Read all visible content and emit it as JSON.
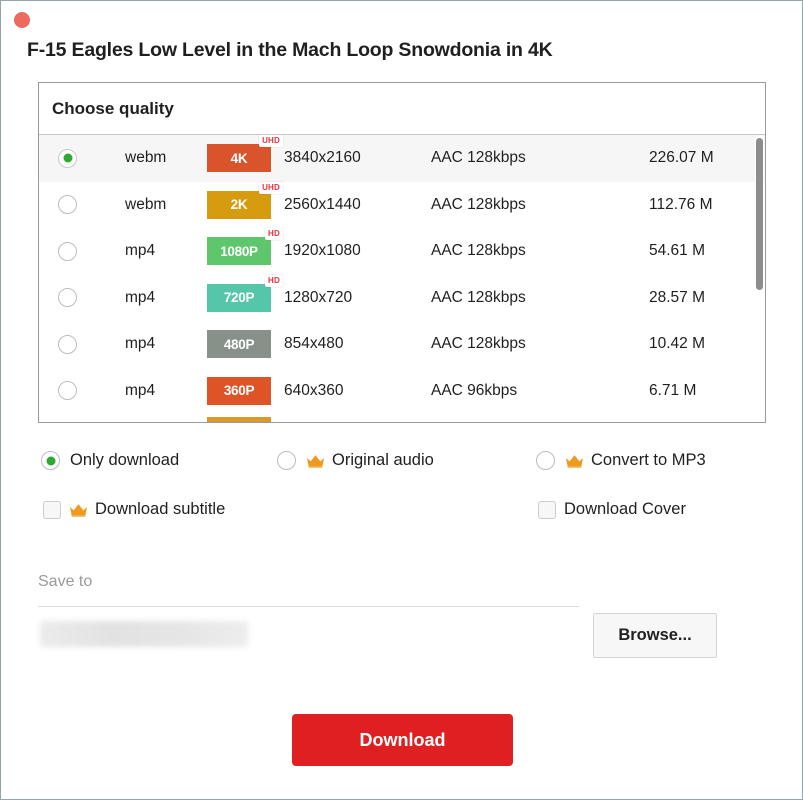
{
  "window": {
    "close_label": "close",
    "video_title": "F-15 Eagles Low Level in the Mach Loop Snowdonia in 4K"
  },
  "quality_panel": {
    "header_label": "Choose quality",
    "rows": [
      {
        "format": "webm",
        "badge": "4K",
        "badge_tag": "UHD",
        "badge_color": "#d9542b",
        "resolution": "3840x2160",
        "audio": "AAC 128kbps",
        "size": "226.07 M",
        "selected": true
      },
      {
        "format": "webm",
        "badge": "2K",
        "badge_tag": "UHD",
        "badge_color": "#d79b10",
        "resolution": "2560x1440",
        "audio": "AAC 128kbps",
        "size": "112.76 M",
        "selected": false
      },
      {
        "format": "mp4",
        "badge": "1080P",
        "badge_tag": "HD",
        "badge_color": "#5fc76b",
        "resolution": "1920x1080",
        "audio": "AAC 128kbps",
        "size": "54.61 M",
        "selected": false
      },
      {
        "format": "mp4",
        "badge": "720P",
        "badge_tag": "HD",
        "badge_color": "#55c6a9",
        "resolution": "1280x720",
        "audio": "AAC 128kbps",
        "size": "28.57 M",
        "selected": false
      },
      {
        "format": "mp4",
        "badge": "480P",
        "badge_tag": "",
        "badge_color": "#879089",
        "resolution": "854x480",
        "audio": "AAC 128kbps",
        "size": "10.42 M",
        "selected": false
      },
      {
        "format": "mp4",
        "badge": "360P",
        "badge_tag": "",
        "badge_color": "#de5427",
        "resolution": "640x360",
        "audio": "AAC 96kbps",
        "size": "6.71 M",
        "selected": false
      }
    ]
  },
  "options": {
    "only_download": "Only download",
    "original_audio": "Original audio",
    "convert_to_mp3": "Convert to MP3",
    "download_subtitle": "Download subtitle",
    "download_cover": "Download Cover",
    "selected_mode": "Only download"
  },
  "save_to": {
    "label": "Save to",
    "path_value": "",
    "browse_label": "Browse..."
  },
  "actions": {
    "download_label": "Download"
  },
  "colors": {
    "accent_red": "#e01f21",
    "close_dot": "#ec6a5e",
    "radio_green": "#2eaa33",
    "crown_orange": "#f0991f",
    "tag_red": "#e8323c"
  }
}
